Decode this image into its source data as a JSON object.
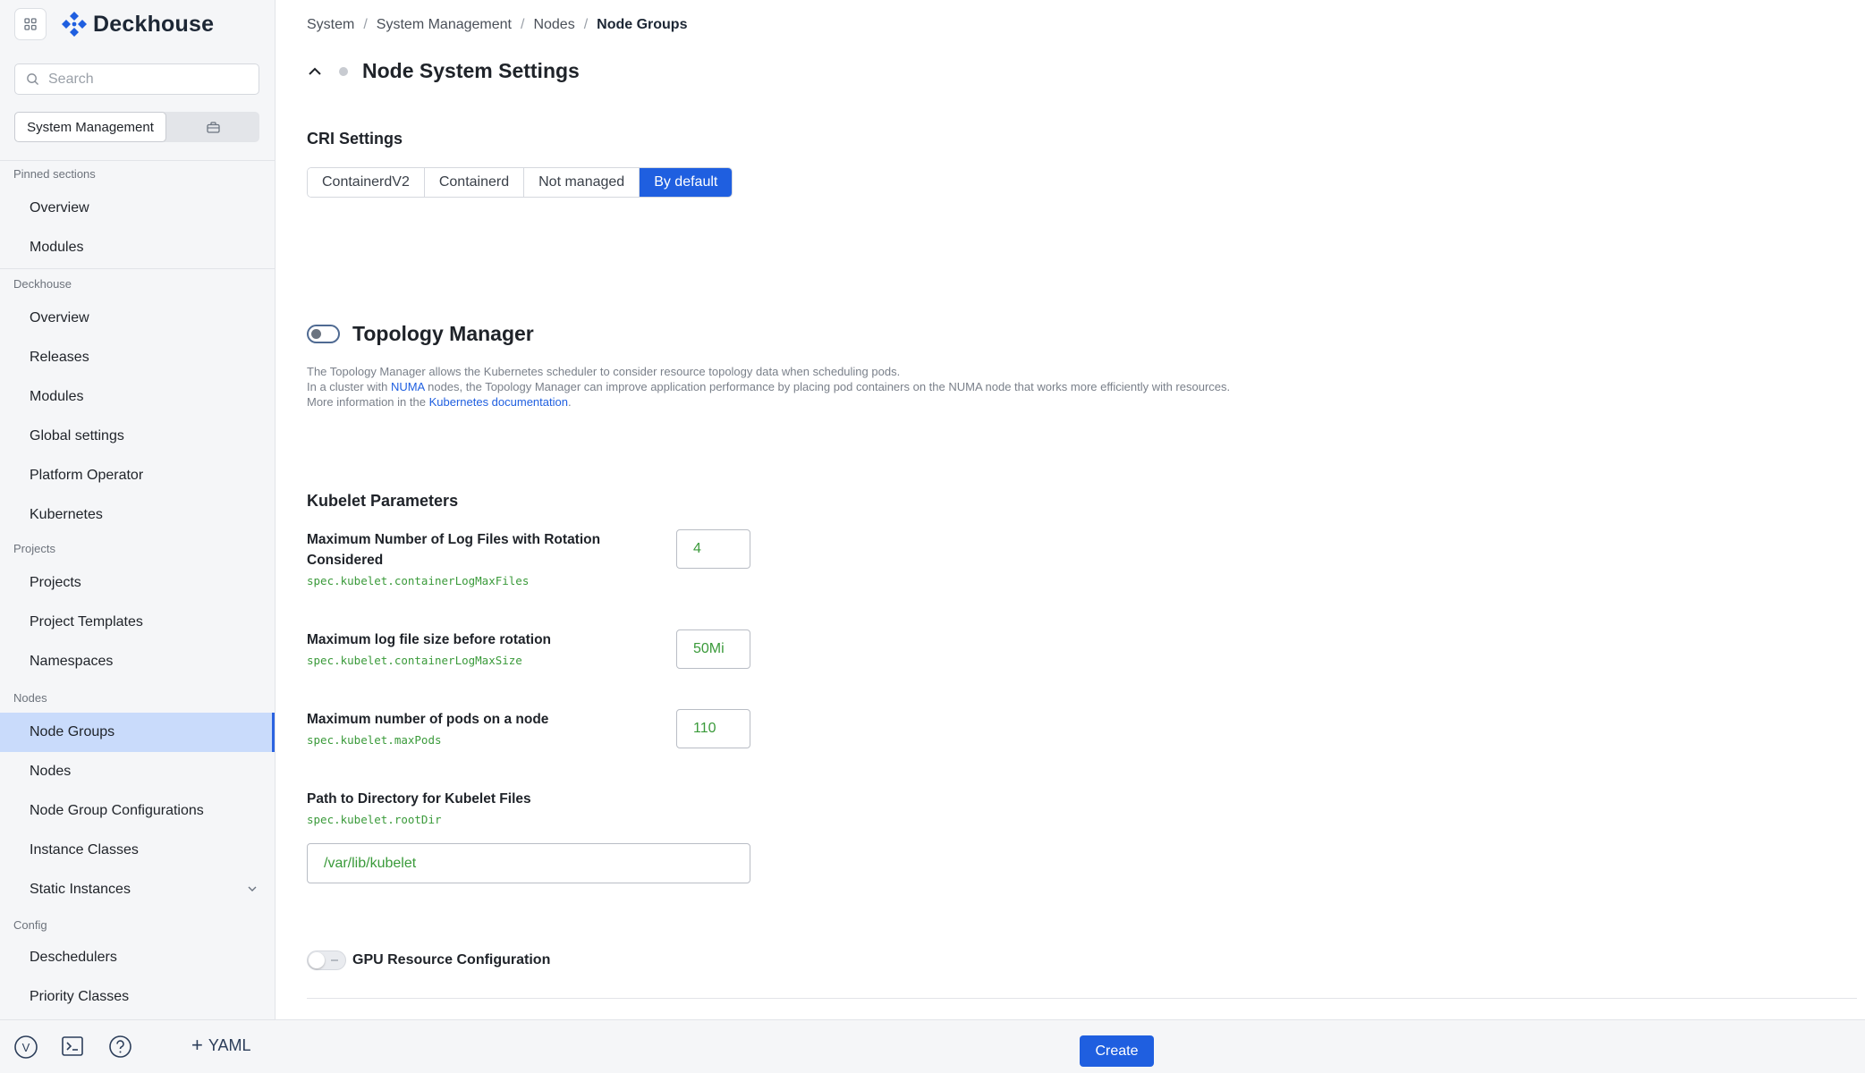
{
  "app": {
    "name": "Deckhouse"
  },
  "sidebar": {
    "search_placeholder": "Search",
    "context_label": "System Management",
    "sections": [
      {
        "title": "Pinned sections",
        "items": [
          "Overview",
          "Modules"
        ]
      },
      {
        "title": "Deckhouse",
        "items": [
          "Overview",
          "Releases",
          "Modules",
          "Global settings",
          "Platform Operator",
          "Kubernetes"
        ]
      },
      {
        "title": "Projects",
        "items": [
          "Projects",
          "Project Templates",
          "Namespaces"
        ]
      },
      {
        "title": "Nodes",
        "items": [
          "Node Groups",
          "Nodes",
          "Node Group Configurations",
          "Instance Classes",
          "Static Instances"
        ]
      },
      {
        "title": "Config",
        "items": [
          "Deschedulers",
          "Priority Classes"
        ]
      }
    ],
    "active_item": "Node Groups",
    "bottom": {
      "user_initial": "V",
      "yaml_label": "YAML"
    }
  },
  "breadcrumb": [
    "System",
    "System Management",
    "Nodes",
    "Node Groups"
  ],
  "page_title": "Node System Settings",
  "cri": {
    "heading": "CRI Settings",
    "options": [
      "ContainerdV2",
      "Containerd",
      "Not managed",
      "By default"
    ],
    "selected": "By default"
  },
  "topology": {
    "title": "Topology Manager",
    "enabled": false,
    "line1": "The Topology Manager allows the Kubernetes scheduler to consider resource topology data when scheduling pods.",
    "line2_pre": "In a cluster with ",
    "line2_link": "NUMA",
    "line2_post": " nodes, the Topology Manager can improve application performance by placing pod containers on the NUMA node that works more efficiently with resources.",
    "line3_pre": "More information in the ",
    "line3_link": "Kubernetes documentation",
    "line3_post": "."
  },
  "kubelet": {
    "heading": "Kubelet Parameters",
    "fields": [
      {
        "label": "Maximum Number of Log Files with Rotation Considered",
        "path": "spec.kubelet.containerLogMaxFiles",
        "value": "4"
      },
      {
        "label": "Maximum log file size before rotation",
        "path": "spec.kubelet.containerLogMaxSize",
        "value": "50Mi"
      },
      {
        "label": "Maximum number of pods on a node",
        "path": "spec.kubelet.maxPods",
        "value": "110"
      },
      {
        "label": "Path to Directory for Kubelet Files",
        "path": "spec.kubelet.rootDir",
        "value": "/var/lib/kubelet"
      }
    ]
  },
  "gpu": {
    "label": "GPU Resource Configuration",
    "enabled": false
  },
  "footer": {
    "create_label": "Create"
  },
  "colors": {
    "accent": "#1f5fe0",
    "active_nav": "#c9dbfb",
    "code_green": "#3a9a3a"
  }
}
